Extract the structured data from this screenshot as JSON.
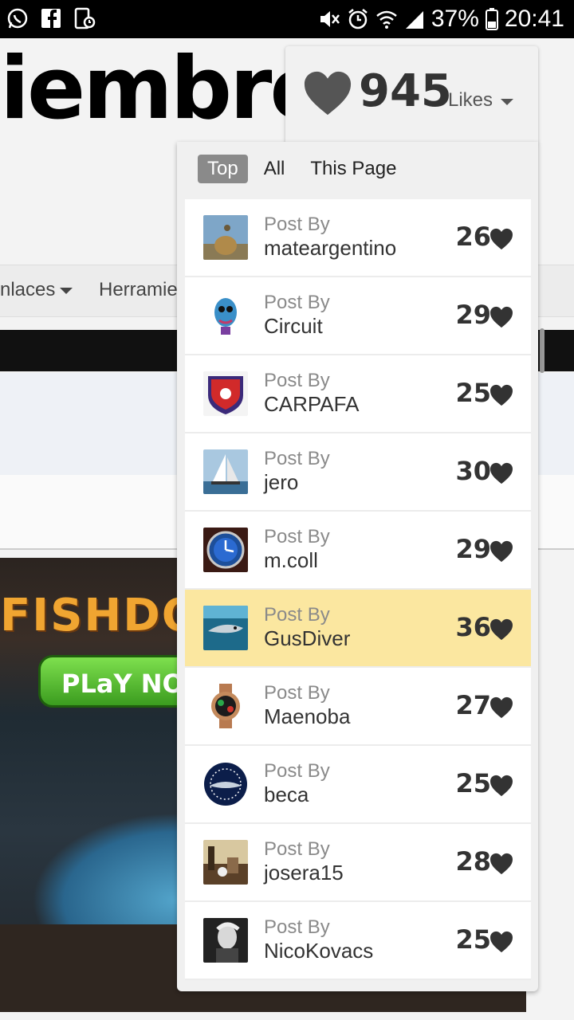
{
  "status_bar": {
    "left_icons": [
      "whatsapp-icon",
      "facebook-icon",
      "phone-app-icon"
    ],
    "right_icons": [
      "mute-icon",
      "alarm-icon",
      "wifi-icon",
      "signal-icon",
      "battery-icon"
    ],
    "battery": "37%",
    "time": "20:41"
  },
  "page": {
    "title": "iembre",
    "nav_enlaces": "nlaces",
    "nav_herramientas": "Herramie",
    "banner_logo": "FISHDO",
    "banner_button": "PLaY NOW"
  },
  "likes": {
    "count": "945",
    "label": "Likes",
    "heart_color": "#555555"
  },
  "tabs": [
    {
      "label": "Top",
      "active": true
    },
    {
      "label": "All",
      "active": false
    },
    {
      "label": "This Page",
      "active": false
    }
  ],
  "posts": [
    {
      "prefix": "Post By",
      "user": "mateargentino",
      "likes": "26",
      "highlight": false
    },
    {
      "prefix": "Post By",
      "user": "Circuit",
      "likes": "29",
      "highlight": false
    },
    {
      "prefix": "Post By",
      "user": "CARPAFA",
      "likes": "25",
      "highlight": false
    },
    {
      "prefix": "Post By",
      "user": "jero",
      "likes": "30",
      "highlight": false
    },
    {
      "prefix": "Post By",
      "user": "m.coll",
      "likes": "29",
      "highlight": false
    },
    {
      "prefix": "Post By",
      "user": "GusDiver",
      "likes": "36",
      "highlight": true
    },
    {
      "prefix": "Post By",
      "user": "Maenoba",
      "likes": "27",
      "highlight": false
    },
    {
      "prefix": "Post By",
      "user": "beca",
      "likes": "25",
      "highlight": false
    },
    {
      "prefix": "Post By",
      "user": "josera15",
      "likes": "28",
      "highlight": false
    },
    {
      "prefix": "Post By",
      "user": "NicoKovacs",
      "likes": "25",
      "highlight": false
    }
  ],
  "colors": {
    "highlight_row": "#fbe7a0",
    "active_tab": "#8a8a8a"
  }
}
